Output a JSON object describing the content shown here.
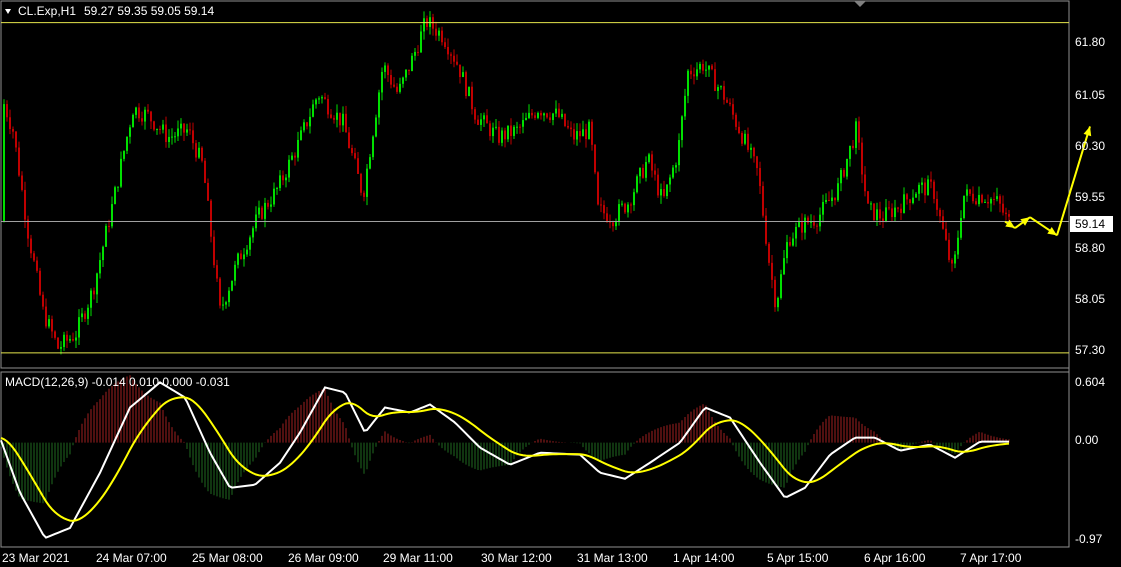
{
  "header": {
    "symbol": "CL.Exp,H1",
    "ohlc": "59.27 59.35 59.05 59.14"
  },
  "price_axis": {
    "ticks": [
      "61.80",
      "61.05",
      "60.30",
      "59.55",
      "58.80",
      "58.05",
      "57.30"
    ],
    "current_price": "59.14"
  },
  "indicator": {
    "label": "MACD(12,26,9) -0.014 0.010 0.000 -0.031",
    "ticks": [
      "0.604",
      "0.00",
      "-0.97"
    ]
  },
  "time_axis": {
    "ticks": [
      "23 Mar 2021",
      "24 Mar 07:00",
      "25 Mar 08:00",
      "26 Mar 09:00",
      "29 Mar 11:00",
      "30 Mar 12:00",
      "31 Mar 13:00",
      "1 Apr 14:00",
      "5 Apr 15:00",
      "6 Apr 16:00",
      "7 Apr 17:00"
    ]
  },
  "colors": {
    "bull": "#00e000",
    "bear": "#c00000",
    "level_line": "#e6e64c",
    "macd_line": "#ffffff",
    "signal_line": "#ffff00",
    "arrow": "#ffff00"
  },
  "chart_data": {
    "type": "candlestick",
    "price_range": [
      57.15,
      62.15
    ],
    "levels": [
      61.88,
      57.33
    ],
    "current_price": 59.14,
    "forecast_path": [
      59.14,
      59.05,
      59.2,
      58.95,
      60.45
    ],
    "macd_range": [
      -0.97,
      0.604
    ]
  }
}
